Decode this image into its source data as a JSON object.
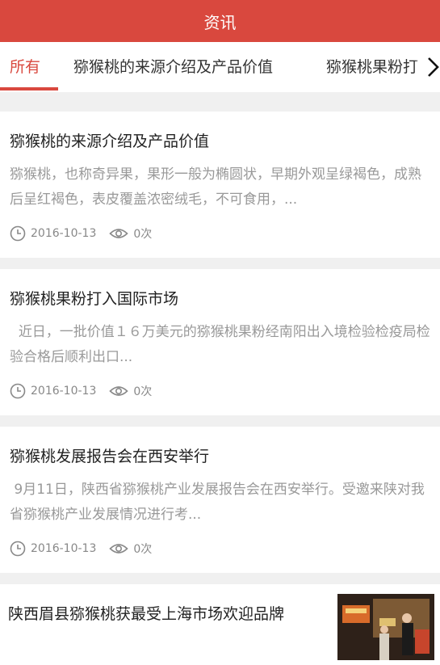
{
  "header": {
    "title": "资讯"
  },
  "tabs": [
    {
      "label": "所有",
      "active": true
    },
    {
      "label": "猕猴桃的来源介绍及产品价值",
      "active": false
    },
    {
      "label": "猕猴桃果粉打",
      "active": false
    }
  ],
  "articles": [
    {
      "title": "猕猴桃的来源介绍及产品价值",
      "desc": "猕猴桃，也称奇异果，果形一般为椭圆状，早期外观呈绿褐色，成熟后呈红褐色，表皮覆盖浓密绒毛，不可食用，...",
      "date": "2016-10-13",
      "views": "0次"
    },
    {
      "title": "猕猴桃果粉打入国际市场",
      "desc": "  近日，一批价值１６万美元的猕猴桃果粉经南阳出入境检验检疫局检验合格后顺利出口...",
      "date": "2016-10-13",
      "views": "0次"
    },
    {
      "title": "猕猴桃发展报告会在西安举行",
      "desc": " 9月11日，陕西省猕猴桃产业发展报告会在西安举行。受邀来陕对我省猕猴桃产业发展情况进行考...",
      "date": "2016-10-13",
      "views": "0次"
    }
  ],
  "featured": {
    "title": "陕西眉县猕猴桃获最受上海市场欢迎品牌"
  },
  "colors": {
    "accent": "#d9483e",
    "background": "#f0f0f0"
  }
}
